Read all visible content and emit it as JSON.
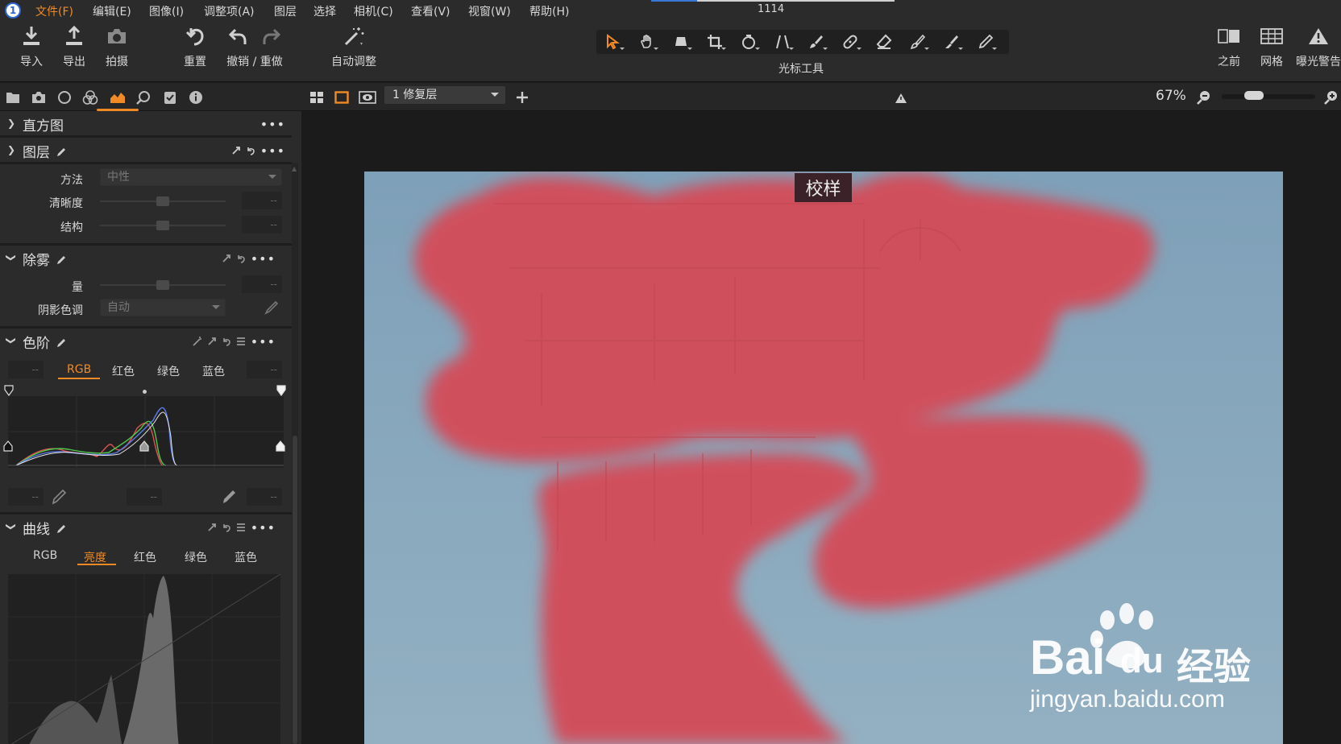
{
  "menu": {
    "logo": "1",
    "items": [
      "文件(F)",
      "编辑(E)",
      "图像(I)",
      "调整项(A)",
      "图层",
      "选择",
      "相机(C)",
      "查看(V)",
      "视窗(W)",
      "帮助(H)"
    ],
    "active_index": 0,
    "doc_title": "1114",
    "progress": 0.19
  },
  "toolbar": {
    "import": "导入",
    "export": "导出",
    "capture": "拍摄",
    "reset": "重置",
    "undo_redo": "撤销 / 重做",
    "auto_adjust": "自动调整",
    "cursor_tools": "光标工具",
    "before": "之前",
    "grid": "网格",
    "exposure_warning": "曝光警告"
  },
  "panel": {
    "histogram": {
      "title": "直方图"
    },
    "layers": {
      "title": "图层"
    },
    "clarity": {
      "method_label": "方法",
      "method_value": "中性",
      "clarity_label": "清晰度",
      "clarity_value": "--",
      "structure_label": "结构",
      "structure_value": "--"
    },
    "dehaze": {
      "title": "除雾",
      "amount_label": "量",
      "amount_value": "--",
      "shadow_label": "阴影色调",
      "shadow_value": "自动"
    },
    "levels": {
      "title": "色阶",
      "left_value": "--",
      "right_value": "--",
      "channels": [
        "RGB",
        "红色",
        "绿色",
        "蓝色"
      ],
      "active_channel": 0,
      "out_left": "--",
      "out_mid": "--",
      "out_right": "--"
    },
    "curves": {
      "title": "曲线",
      "channels": [
        "RGB",
        "亮度",
        "红色",
        "绿色",
        "蓝色"
      ],
      "active_channel": 1
    }
  },
  "viewer": {
    "layer_select": "1 修复层",
    "zoom": "67%",
    "zoom_level": 0.3,
    "proof_badge": "校样"
  },
  "colors": {
    "accent": "#f08a24",
    "sky": "#8aa8bc",
    "mask": "#d0505d"
  },
  "watermark": {
    "brand": "Bai",
    "brand2": "du",
    "cn": "经验",
    "url": "jingyan.baidu.com"
  }
}
